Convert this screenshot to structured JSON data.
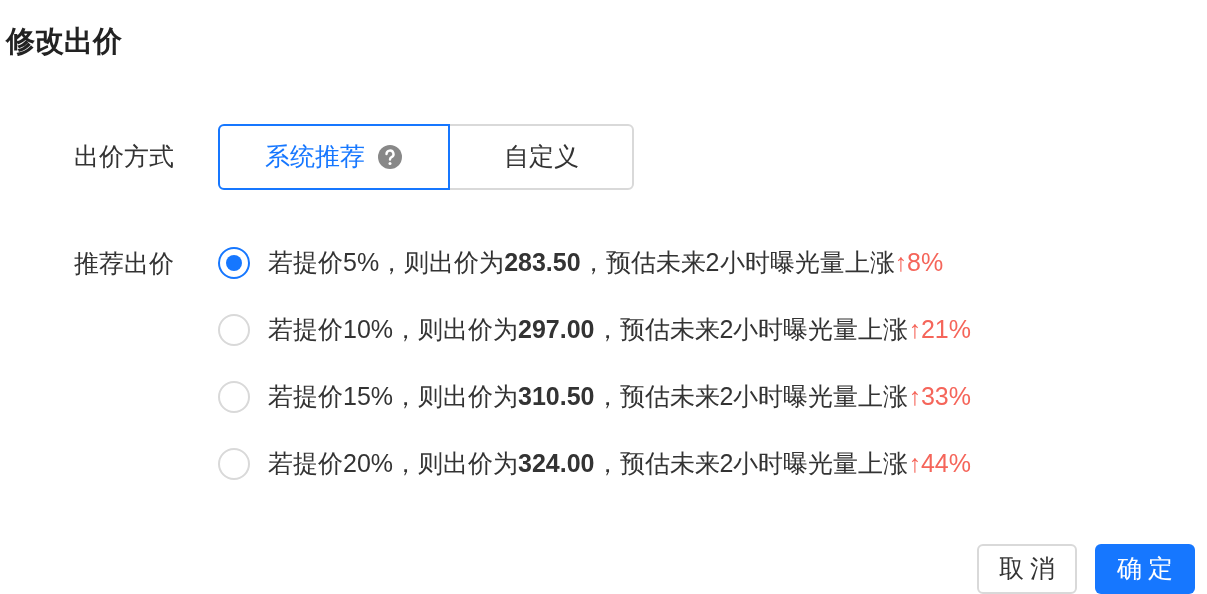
{
  "title": "修改出价",
  "bid_mode": {
    "label": "出价方式",
    "options": [
      {
        "label": "系统推荐",
        "selected": true,
        "help": true
      },
      {
        "label": "自定义",
        "selected": false,
        "help": false
      }
    ]
  },
  "recommended": {
    "label": "推荐出价",
    "options": [
      {
        "text": "若提价5%，则出价为**283.50**，预估未来2小时曝光量上涨",
        "change": "↑8%",
        "selected": true
      },
      {
        "text": "若提价10%，则出价为**297.00**，预估未来2小时曝光量上涨",
        "change": "↑21%",
        "selected": false
      },
      {
        "text": "若提价15%，则出价为**310.50**，预估未来2小时曝光量上涨",
        "change": "↑33%",
        "selected": false
      },
      {
        "text": "若提价20%，则出价为**324.00**，预估未来2小时曝光量上涨",
        "change": "↑44%",
        "selected": false
      }
    ]
  },
  "buttons": [
    {
      "label": "取 消",
      "kind": "secondary"
    },
    {
      "label": "确 定",
      "kind": "primary"
    }
  ]
}
